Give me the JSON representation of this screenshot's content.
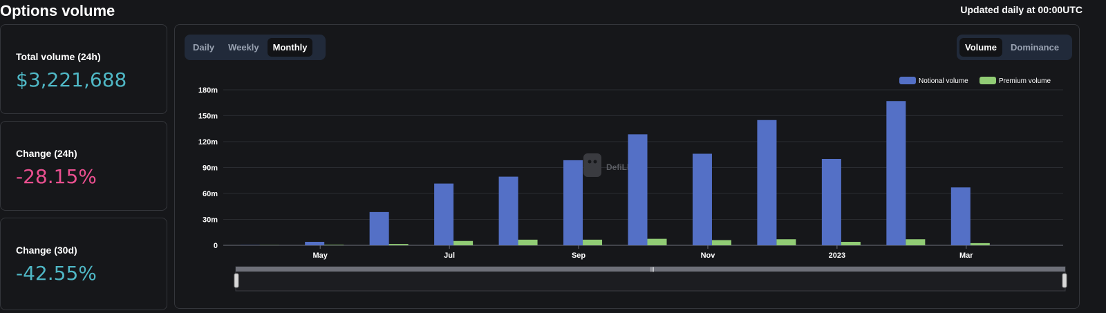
{
  "header": {
    "title": "Options volume",
    "updated": "Updated daily at 00:00UTC"
  },
  "stats": [
    {
      "label": "Total volume (24h)",
      "value": "$3,221,688",
      "color": "#4fb7c5"
    },
    {
      "label": "Change (24h)",
      "value": "-28.15%",
      "color": "#e94f8f"
    },
    {
      "label": "Change (30d)",
      "value": "-42.55%",
      "color": "#4fb7c5"
    }
  ],
  "controls": {
    "period_tabs": [
      "Daily",
      "Weekly",
      "Monthly"
    ],
    "period_active": "Monthly",
    "view_tabs": [
      "Volume",
      "Dominance"
    ],
    "view_active": "Volume"
  },
  "watermark": "DefiLlama",
  "colors": {
    "notional": "#5470c6",
    "premium": "#91cc75"
  },
  "chart_data": {
    "type": "bar",
    "categories": [
      "Apr 2022",
      "May 2022",
      "Jun 2022",
      "Jul 2022",
      "Aug 2022",
      "Sep 2022",
      "Oct 2022",
      "Nov 2022",
      "Dec 2022",
      "Jan 2023",
      "Feb 2023",
      "Mar 2023",
      "Apr 2023"
    ],
    "x_tick_labels": [
      {
        "label": "May",
        "category": "May 2022",
        "bold": false
      },
      {
        "label": "Jul",
        "category": "Jul 2022",
        "bold": false
      },
      {
        "label": "Sep",
        "category": "Sep 2022",
        "bold": false
      },
      {
        "label": "Nov",
        "category": "Nov 2022",
        "bold": false
      },
      {
        "label": "2023",
        "category": "Jan 2023",
        "bold": true
      },
      {
        "label": "Mar",
        "category": "Mar 2023",
        "bold": false
      }
    ],
    "series": [
      {
        "name": "Notional volume",
        "values": [
          0.3,
          4,
          38.5,
          71.5,
          79.5,
          98.5,
          128.5,
          106,
          145,
          100,
          167,
          67,
          0
        ]
      },
      {
        "name": "Premium volume",
        "values": [
          0.2,
          0.6,
          1.5,
          5,
          6.5,
          6.5,
          7.5,
          6,
          7,
          4,
          7,
          2.5,
          0
        ]
      }
    ],
    "ylim": [
      0,
      180
    ],
    "y_ticks": [
      "0",
      "30m",
      "60m",
      "90m",
      "120m",
      "150m",
      "180m"
    ],
    "legend_position": "top-right",
    "grid": true
  }
}
